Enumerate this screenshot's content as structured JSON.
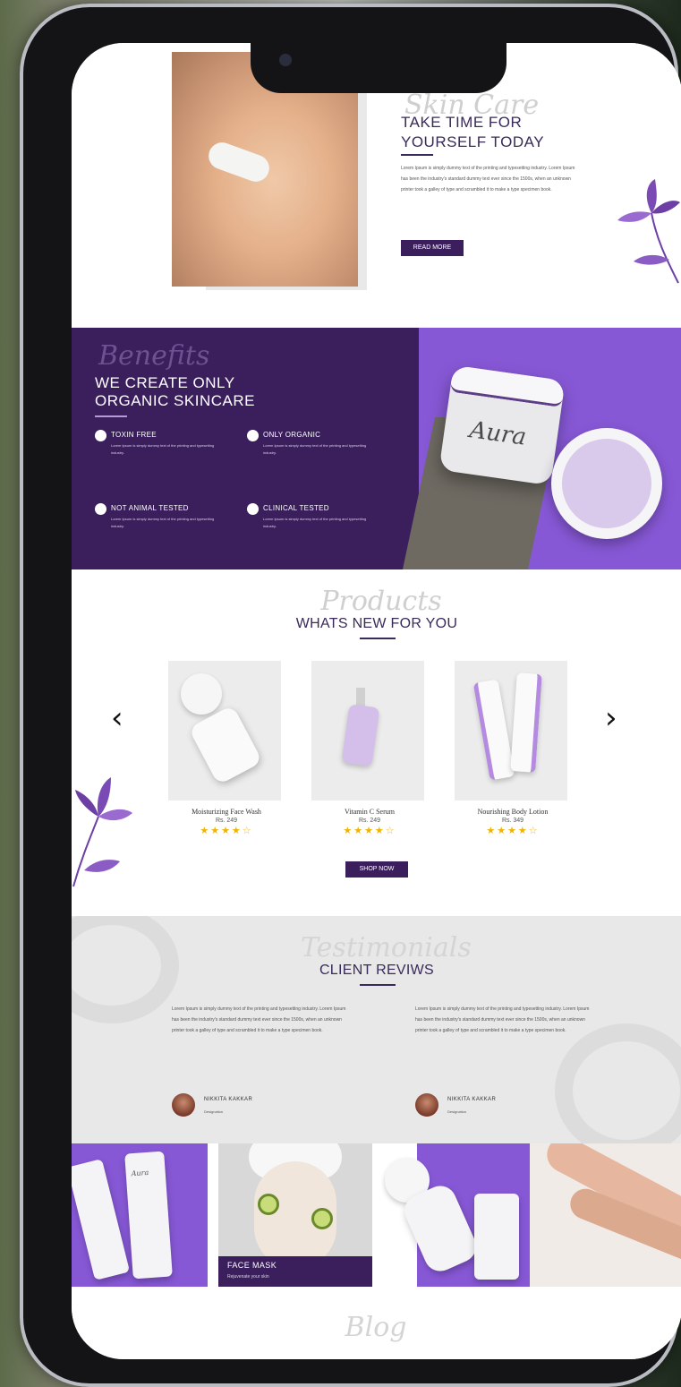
{
  "colors": {
    "brand_dark": "#3b1f5d",
    "brand_light": "#8758d6",
    "star": "#f0b400",
    "review_bg": "#e8e8e8"
  },
  "hero": {
    "script": "Skin Care",
    "title_line1": "TAKE TIME FOR",
    "title_line2": "YOURSELF TODAY",
    "body": "Lorem Ipsum is simply dummy text of the printing and typesetting industry. Lorem Ipsum has been the industry's standard dummy text ever since the 1500s, when an unknown printer took a galley of type and scrambled it to make a type specimen book.",
    "button": "READ MORE"
  },
  "benefits": {
    "script": "Benefits",
    "title_line1": "WE CREATE ONLY",
    "title_line2": "ORGANIC SKINCARE",
    "product_brand": "Aura",
    "features": [
      {
        "label": "TOXIN FREE",
        "icon": "leaf-icon",
        "desc": "Lorem Ipsum is simply dummy text of the printing and typesetting industry."
      },
      {
        "label": "ONLY ORGANIC",
        "icon": "organic-icon",
        "desc": "Lorem Ipsum is simply dummy text of the printing and typesetting industry."
      },
      {
        "label": "NOT ANIMAL TESTED",
        "icon": "rabbit-icon",
        "desc": "Lorem Ipsum is simply dummy text of the printing and typesetting industry."
      },
      {
        "label": "CLINICAL TESTED",
        "icon": "flask-icon",
        "desc": "Lorem Ipsum is simply dummy text of the printing and typesetting industry."
      }
    ]
  },
  "products": {
    "script": "Products",
    "title": "WHATS NEW FOR YOU",
    "prev": "‹",
    "next": "›",
    "button": "SHOP NOW",
    "items": [
      {
        "name": "Moisturizing Face Wash",
        "price": "Rs. 249",
        "stars": "★★★★☆",
        "rating": 4
      },
      {
        "name": "Vitamin C Serum",
        "price": "Rs. 249",
        "stars": "★★★★☆",
        "rating": 4
      },
      {
        "name": "Nourishing Body Lotion",
        "price": "Rs. 349",
        "stars": "★★★★☆",
        "rating": 4
      }
    ]
  },
  "reviews": {
    "script": "Testimonials",
    "title": "CLIENT REVIWS",
    "items": [
      {
        "text": "Lorem Ipsum is simply dummy text of the printing and typesetting industry. Lorem Ipsum has been the industry's standard dummy text ever since the 1500s, when an unknown printer took a galley of type and scrambled it to make a type specimen book.",
        "name": "NIKKITA KAKKAR",
        "role": "Designation"
      },
      {
        "text": "Lorem Ipsum is simply dummy text of the printing and typesetting industry. Lorem Ipsum has been the industry's standard dummy text ever since the 1500s, when an unknown printer took a galley of type and scrambled it to make a type specimen book.",
        "name": "NIKKITA KAKKAR",
        "role": "Designation"
      }
    ]
  },
  "gallery": {
    "mask_title": "FACE MASK",
    "mask_sub": "Rejuvenate your skin",
    "brand": "Aura"
  },
  "blog": {
    "script": "Blog"
  }
}
